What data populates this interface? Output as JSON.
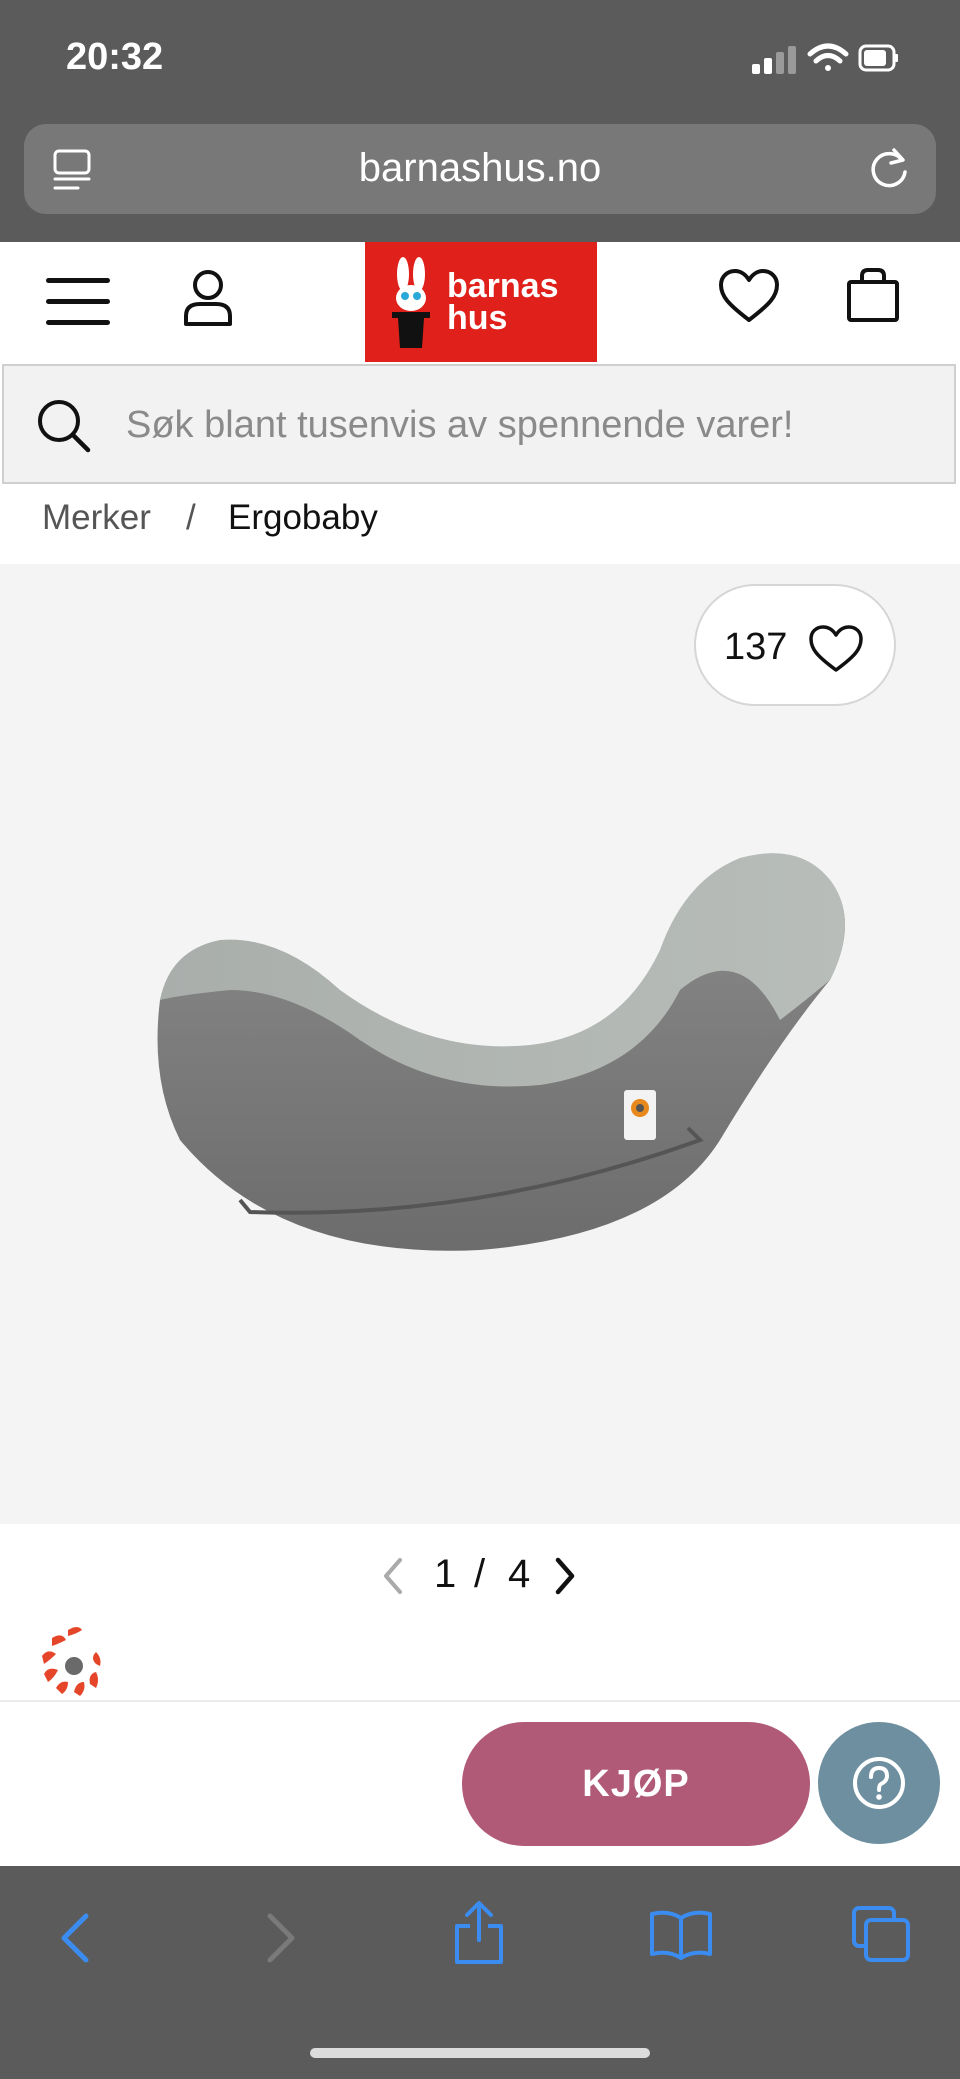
{
  "status_bar": {
    "time": "20:32"
  },
  "browser": {
    "url": "barnashus.no"
  },
  "site": {
    "logo_line1": "barnas",
    "logo_line2": "hus",
    "search_placeholder": "Søk blant tusenvis av spennende varer!"
  },
  "breadcrumb": {
    "parent": "Merker",
    "separator": "/",
    "current": "Ergobaby"
  },
  "product": {
    "likes": "137",
    "pager_current": "1",
    "pager_separator": "/",
    "pager_total": "4"
  },
  "actions": {
    "buy_label": "KJØP"
  },
  "colors": {
    "brand_red": "#e0201b",
    "buy_button": "#b05a78",
    "help_button": "#6e8fa0",
    "ios_blue": "#3b8cf0"
  },
  "icons": [
    "menu-icon",
    "account-icon",
    "heart-icon",
    "bag-icon",
    "search-icon",
    "reader-icon",
    "reload-icon",
    "chevron-left-icon",
    "chevron-right-icon",
    "question-icon",
    "back-icon",
    "forward-icon",
    "share-icon",
    "bookmarks-icon",
    "tabs-icon"
  ]
}
